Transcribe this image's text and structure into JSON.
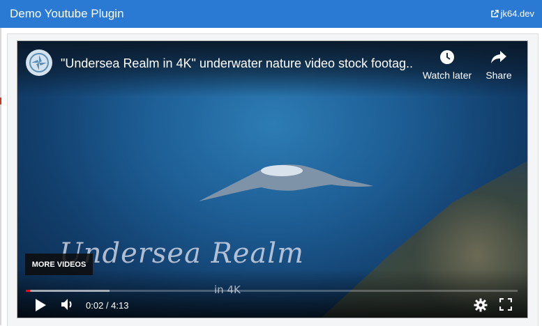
{
  "app": {
    "title": "Demo Youtube Plugin",
    "external_link": "jk64.dev"
  },
  "player": {
    "video_title": "\"Undersea Realm in 4K\" underwater nature video stock footag...",
    "watch_later_label": "Watch later",
    "share_label": "Share",
    "more_videos_label": "MORE VIDEOS",
    "overlay_brand": "Undersea Realm",
    "overlay_sub": "in 4K",
    "time_display": "0:02 / 4:13",
    "progress_played_fraction": 0.008,
    "progress_buffered_fraction": 0.17
  },
  "icons": {
    "external_link": "external-link-icon",
    "channel_logo": "channel-logo-icon",
    "watch_later": "clock-icon",
    "share": "share-arrow-icon",
    "play": "play-icon",
    "volume": "volume-icon",
    "settings": "gear-icon",
    "fullscreen": "fullscreen-icon"
  },
  "colors": {
    "header": "#2a7ad4",
    "progress_played": "#ff0000"
  }
}
